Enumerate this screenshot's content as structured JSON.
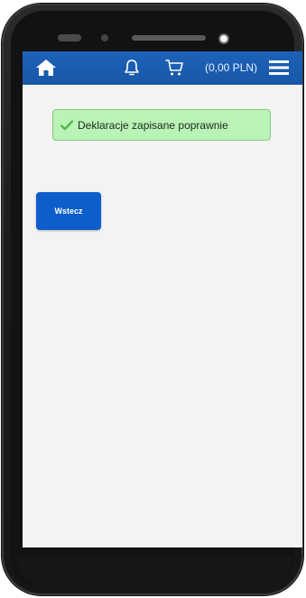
{
  "header": {
    "home_icon": "home-icon",
    "notifications_icon": "bell-icon",
    "cart_icon": "cart-icon",
    "cart_total": "(0,00 PLN)",
    "menu_icon": "hamburger-menu-icon",
    "bar_color": "#1d62b8"
  },
  "alert": {
    "icon": "check-icon",
    "message": "Deklaracje zapisane poprawnie",
    "background": "#b9f3b5"
  },
  "actions": {
    "back_label": "Wstecz",
    "back_color": "#0d5ecb"
  }
}
